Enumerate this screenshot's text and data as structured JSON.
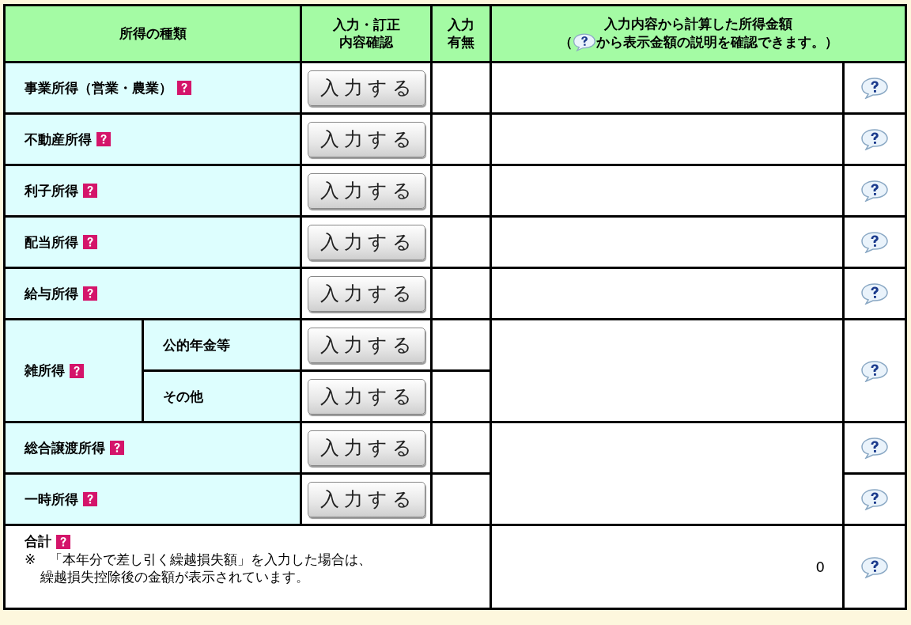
{
  "header": {
    "columns": [
      {
        "lines": [
          "所得の種類"
        ]
      },
      {
        "lines": [
          "入力・訂正",
          "内容確認"
        ]
      },
      {
        "lines": [
          "入力",
          "有無"
        ]
      }
    ],
    "amount_column": {
      "title": "入力内容から計算した所得金額",
      "note_before": "（",
      "note_after": "から表示金額の説明を確認できます。）"
    }
  },
  "rows": [
    {
      "kind": "single",
      "items": [
        {
          "label": "事業所得（営業・農業）",
          "button": "入力する"
        }
      ]
    },
    {
      "kind": "single",
      "items": [
        {
          "label": "不動産所得",
          "button": "入力する"
        }
      ]
    },
    {
      "kind": "single",
      "items": [
        {
          "label": "利子所得",
          "button": "入力する"
        }
      ]
    },
    {
      "kind": "single",
      "items": [
        {
          "label": "配当所得",
          "button": "入力する"
        }
      ]
    },
    {
      "kind": "single",
      "items": [
        {
          "label": "給与所得",
          "button": "入力する"
        }
      ]
    },
    {
      "kind": "split",
      "label": "雑所得",
      "items": [
        {
          "label": "公的年金等",
          "button": "入力する"
        },
        {
          "label": "その他",
          "button": "入力する"
        }
      ]
    },
    {
      "kind": "pair",
      "items": [
        {
          "label": "総合譲渡所得",
          "button": "入力する"
        },
        {
          "label": "一時所得",
          "button": "入力する"
        }
      ]
    }
  ],
  "total": {
    "label": "合計",
    "note_lines": [
      "※　「本年分で差し引く繰越損失額」を入力した場合は、",
      "繰越損失控除後の金額が表示されています。"
    ],
    "amount": "0"
  }
}
